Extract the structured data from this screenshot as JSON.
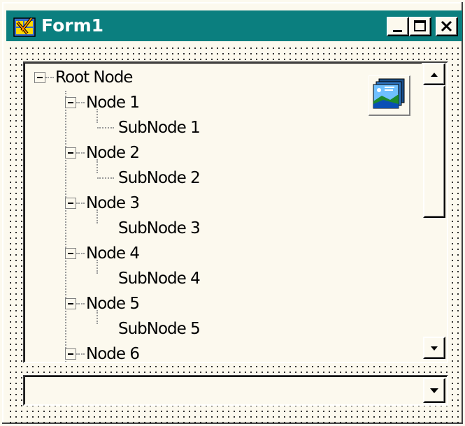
{
  "window": {
    "title": "Form1",
    "icon": "form-app-icon",
    "controls": [
      "minimize-icon",
      "maximize-icon",
      "close-icon"
    ]
  },
  "tree": {
    "root": {
      "label": "Root Node",
      "expanded": true
    },
    "nodes": [
      {
        "label": "Node 1",
        "expanded": true,
        "child": "SubNode 1"
      },
      {
        "label": "Node 2",
        "expanded": true,
        "child": "SubNode 2"
      },
      {
        "label": "Node 3",
        "expanded": true,
        "child": "SubNode 3"
      },
      {
        "label": "Node 4",
        "expanded": true,
        "child": "SubNode 4"
      },
      {
        "label": "Node 5",
        "expanded": true,
        "child": "SubNode 5"
      },
      {
        "label": "Node 6",
        "expanded": true,
        "child": ""
      }
    ],
    "image_icon": "imagelist-picture-icon"
  },
  "combo": {
    "value": ""
  },
  "colors": {
    "titlebar": "#0b7f7f",
    "face": "#fcf9ee"
  }
}
